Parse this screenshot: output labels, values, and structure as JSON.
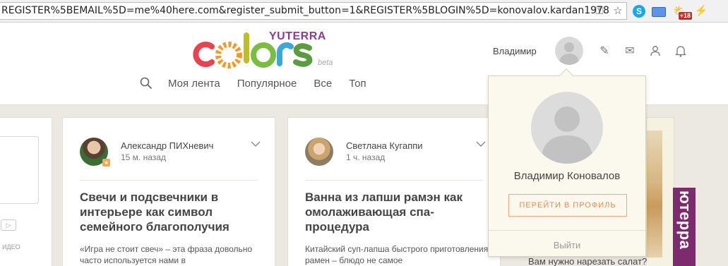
{
  "browser": {
    "url": "REGISTER%5BEMAIL%5D=me%40here.com&register_submit_button=1&REGISTER%5BLOGIN%5D=konovalov.kardan1978",
    "badge": "+18"
  },
  "header": {
    "logo_word": "colors",
    "logo_brand": "YUTERRA",
    "logo_beta": "beta",
    "nav": [
      "Моя лента",
      "Популярное",
      "Все",
      "Топ"
    ],
    "user_name": "Владимир"
  },
  "posts": [
    {
      "author": "Александр ПИХневич",
      "time": "15 м. назад",
      "title": "Свечи и подсвечники в интерьере как символ семейного благополучия",
      "excerpt": "«Игра не стоит свеч» – эта фраза довольно часто используется нами в"
    },
    {
      "author": "Светлана Кугаппи",
      "time": "1 ч. назад",
      "title": "Ванна из лапши рамэн как омолаживающая спа-процедура",
      "excerpt": "Китайский суп-лапша быстрого приготовления рамен – блюдо не самое"
    }
  ],
  "left_card": {
    "video_label": "ИДЕО"
  },
  "side_banner": "ютерра",
  "bottom_question": "Вам нужно нарезать салат?",
  "dropdown": {
    "full_name": "Владимир Коновалов",
    "profile_button": "ПЕРЕЙТИ В ПРОФИЛЬ",
    "logout": "Выйти"
  },
  "colors": {
    "accent": "#ef8a4c",
    "brand_purple": "#8a3d95"
  }
}
